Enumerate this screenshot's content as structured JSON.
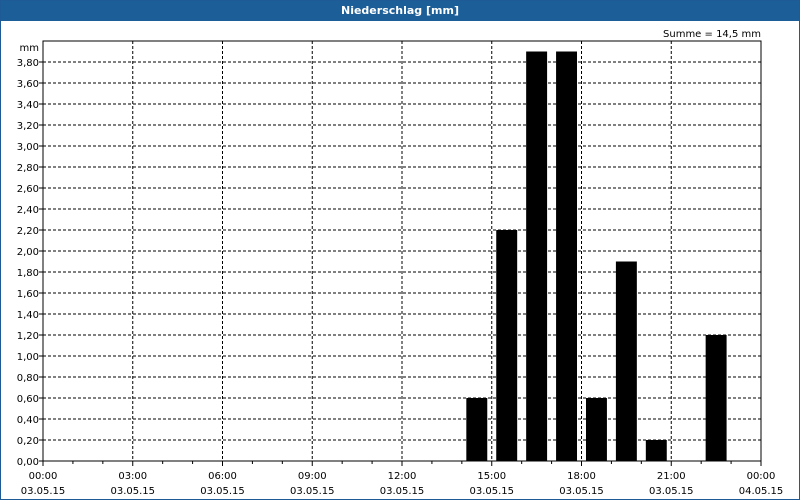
{
  "chart_data": {
    "type": "bar",
    "title": "Niederschlag [mm]",
    "ylabel": "mm",
    "annotation": "Summe = 14,5 mm",
    "ylim": [
      0,
      4.0
    ],
    "grid": true,
    "yticks": [
      "0,00",
      "0,20",
      "0,40",
      "0,60",
      "0,80",
      "1,00",
      "1,20",
      "1,40",
      "1,60",
      "1,80",
      "2,00",
      "2,20",
      "2,40",
      "2,60",
      "2,80",
      "3,00",
      "3,20",
      "3,40",
      "3,60",
      "3,80"
    ],
    "xticks": [
      {
        "time": "00:00",
        "date": "03.05.15"
      },
      {
        "time": "03:00",
        "date": "03.05.15"
      },
      {
        "time": "06:00",
        "date": "03.05.15"
      },
      {
        "time": "09:00",
        "date": "03.05.15"
      },
      {
        "time": "12:00",
        "date": "03.05.15"
      },
      {
        "time": "15:00",
        "date": "03.05.15"
      },
      {
        "time": "18:00",
        "date": "03.05.15"
      },
      {
        "time": "21:00",
        "date": "03.05.15"
      },
      {
        "time": "00:00",
        "date": "04.05.15"
      }
    ],
    "bars": [
      {
        "start": "03.05.15 14:00",
        "end": "03.05.15 15:00",
        "value": 0.6
      },
      {
        "start": "03.05.15 15:00",
        "end": "03.05.15 16:00",
        "value": 2.2
      },
      {
        "start": "03.05.15 16:00",
        "end": "03.05.15 17:00",
        "value": 3.9
      },
      {
        "start": "03.05.15 17:00",
        "end": "03.05.15 18:00",
        "value": 3.9
      },
      {
        "start": "03.05.15 18:00",
        "end": "03.05.15 19:00",
        "value": 0.6
      },
      {
        "start": "03.05.15 19:00",
        "end": "03.05.15 20:00",
        "value": 1.9
      },
      {
        "start": "03.05.15 20:00",
        "end": "03.05.15 21:00",
        "value": 0.2
      },
      {
        "start": "03.05.15 22:00",
        "end": "03.05.15 23:00",
        "value": 1.2
      }
    ],
    "colors": {
      "bar": "#000000",
      "title_bg": "#1c5e98",
      "grid": "#000000"
    }
  }
}
